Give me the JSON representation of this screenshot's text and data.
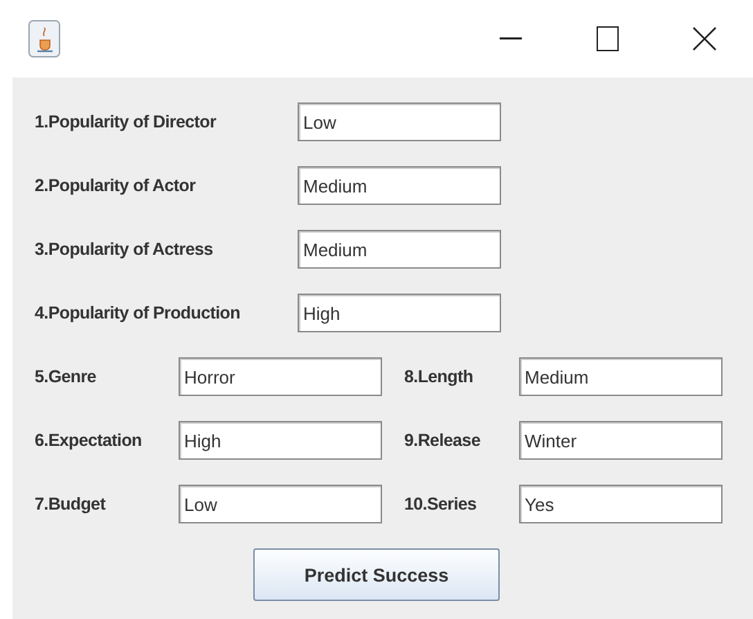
{
  "window": {
    "title_buttons": [
      {
        "kind": "minimize"
      },
      {
        "kind": "maximize"
      },
      {
        "kind": "close"
      }
    ]
  },
  "popularity_fields": [
    {
      "label": "1.Popularity of Director",
      "value": "Low"
    },
    {
      "label": "2.Popularity of Actor",
      "value": "Medium"
    },
    {
      "label": "3.Popularity of Actress",
      "value": "Medium"
    },
    {
      "label": "4.Popularity of Production",
      "value": "High"
    }
  ],
  "left_fields": [
    {
      "label": "5.Genre",
      "value": "Horror"
    },
    {
      "label": "6.Expectation",
      "value": "High"
    },
    {
      "label": "7.Budget",
      "value": "Low"
    }
  ],
  "right_fields": [
    {
      "label": "8.Length",
      "value": "Medium"
    },
    {
      "label": "9.Release",
      "value": "Winter"
    },
    {
      "label": "10.Series",
      "value": "Yes"
    }
  ],
  "button": "Predict Success"
}
